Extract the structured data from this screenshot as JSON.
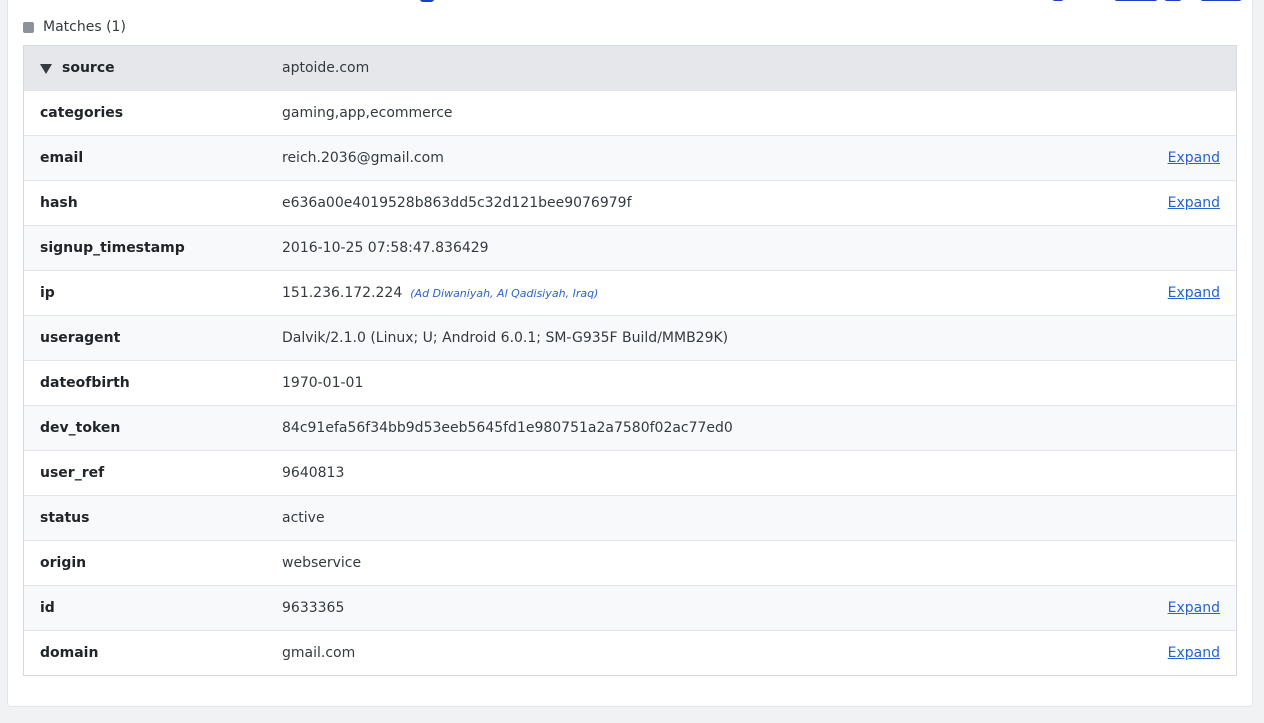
{
  "matches": {
    "label": "Matches (1)"
  },
  "rows": [
    {
      "key": "source",
      "value": "aptoide.com"
    },
    {
      "key": "categories",
      "value": "gaming,app,ecommerce"
    },
    {
      "key": "email",
      "value": "reich.2036@gmail.com",
      "action": "Expand"
    },
    {
      "key": "hash",
      "value": "e636a00e4019528b863dd5c32d121bee9076979f",
      "action": "Expand"
    },
    {
      "key": "signup_timestamp",
      "value": "2016-10-25 07:58:47.836429"
    },
    {
      "key": "ip",
      "value": "151.236.172.224",
      "geo": "(Ad Diwaniyah, Al Qadisiyah, Iraq)",
      "action": "Expand"
    },
    {
      "key": "useragent",
      "value": "Dalvik/2.1.0 (Linux; U; Android 6.0.1; SM-G935F Build/MMB29K)"
    },
    {
      "key": "dateofbirth",
      "value": "1970-01-01"
    },
    {
      "key": "dev_token",
      "value": "84c91efa56f34bb9d53eeb5645fd1e980751a2a7580f02ac77ed0"
    },
    {
      "key": "user_ref",
      "value": "9640813"
    },
    {
      "key": "status",
      "value": "active"
    },
    {
      "key": "origin",
      "value": "webservice"
    },
    {
      "key": "id",
      "value": "9633365",
      "action": "Expand"
    },
    {
      "key": "domain",
      "value": "gmail.com",
      "action": "Expand"
    }
  ]
}
